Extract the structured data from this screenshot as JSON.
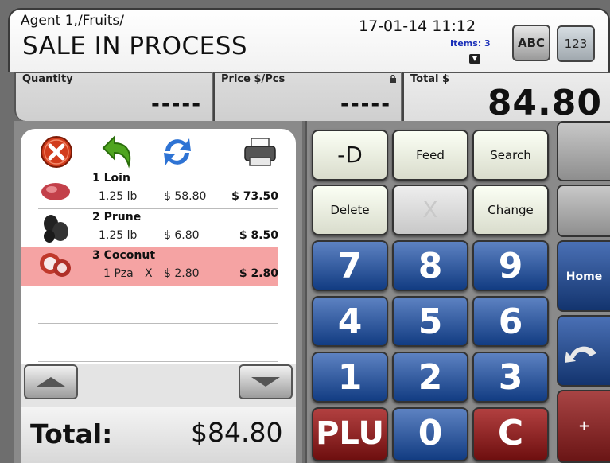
{
  "header": {
    "path": "Agent 1,/Fruits/",
    "title": "SALE IN PROCESS",
    "datetime": "17-01-14 11:12",
    "items_count": "Items: 3",
    "abc_label": "ABC",
    "num_label": "123"
  },
  "fields": {
    "quantity_label": "Quantity",
    "quantity_value": "-----",
    "price_label": "Price $/Pcs",
    "price_value": "-----",
    "total_label": "Total $",
    "total_value": "84.80"
  },
  "toolbar": {
    "icons": [
      "cancel-icon",
      "undo-icon",
      "refresh-icon",
      "printer-icon"
    ]
  },
  "sale_items": [
    {
      "name": "1 Loin",
      "qty": "1.25 lb",
      "flag": "",
      "price": "$ 58.80",
      "total": "$ 73.50",
      "selected": false
    },
    {
      "name": "2 Prune",
      "qty": "1.25 lb",
      "flag": "",
      "price": "$ 6.80",
      "total": "$ 8.50",
      "selected": false
    },
    {
      "name": "3 Coconut",
      "qty": "1 Pza",
      "flag": "X",
      "price": "$ 2.80",
      "total": "$ 2.80",
      "selected": true
    }
  ],
  "footer": {
    "total_label": "Total:",
    "total_amount": "$84.80"
  },
  "keypad": {
    "minus_d": "-D",
    "feed": "Feed",
    "search": "Search",
    "delete": "Delete",
    "x": "X",
    "change": "Change",
    "digits": [
      "7",
      "8",
      "9",
      "4",
      "5",
      "6",
      "1",
      "2",
      "3",
      "0"
    ],
    "plu": "PLU",
    "clear": "C"
  },
  "side": {
    "home": "Home",
    "plus": "+"
  },
  "colors": {
    "selected_row": "#f5a3a3",
    "key_blue": "#1f4a8f",
    "key_red": "#8c1f1f",
    "items_text": "#1a2fb8"
  }
}
